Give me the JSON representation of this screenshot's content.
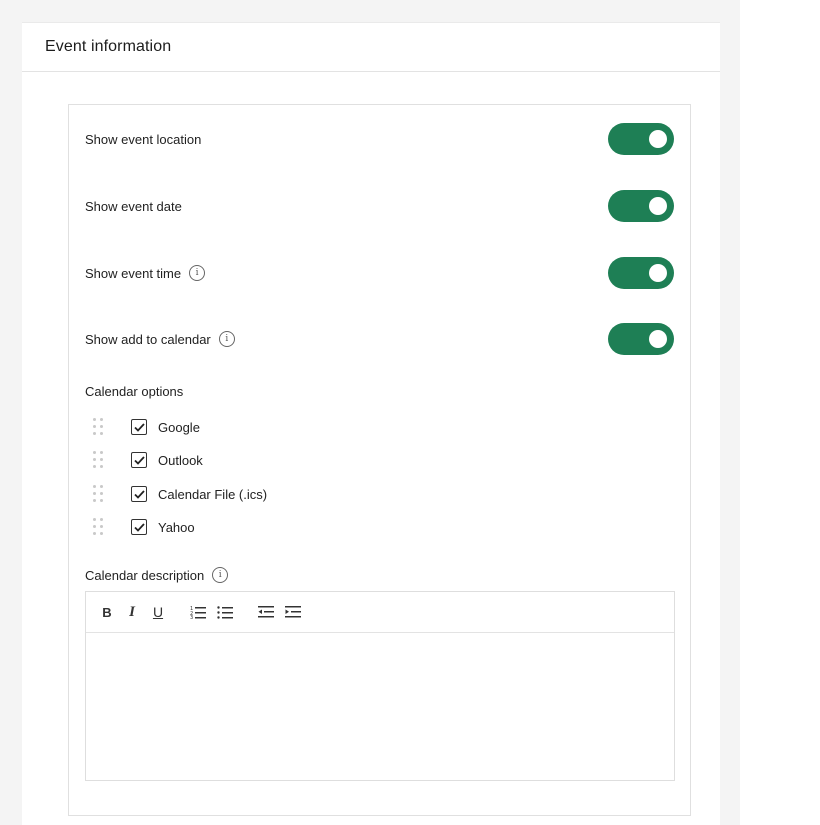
{
  "panel": {
    "title": "Event information"
  },
  "settings": [
    {
      "id": "location",
      "label": "Show event location",
      "info": false,
      "enabled": true
    },
    {
      "id": "date",
      "label": "Show event date",
      "info": false,
      "enabled": true
    },
    {
      "id": "time",
      "label": "Show event time",
      "info": true,
      "enabled": true
    },
    {
      "id": "calendar",
      "label": "Show add to calendar",
      "info": true,
      "enabled": true
    }
  ],
  "calendar_options": {
    "label": "Calendar options",
    "items": [
      {
        "label": "Google",
        "checked": true
      },
      {
        "label": "Outlook",
        "checked": true
      },
      {
        "label": "Calendar File (.ics)",
        "checked": true
      },
      {
        "label": "Yahoo",
        "checked": true
      }
    ]
  },
  "calendar_description": {
    "label": "Calendar description",
    "toolbar": {
      "bold": "B",
      "italic": "I",
      "underline": "U"
    },
    "value": ""
  },
  "icons": {
    "info": "info-icon",
    "check": "check-icon",
    "drag": "drag-handle-icon",
    "ordered_list": "ordered-list-icon",
    "bullet_list": "bullet-list-icon",
    "outdent": "outdent-icon",
    "indent": "indent-icon"
  },
  "colors": {
    "toggle_on": "#1e7f55",
    "border": "#e0e0e0"
  }
}
